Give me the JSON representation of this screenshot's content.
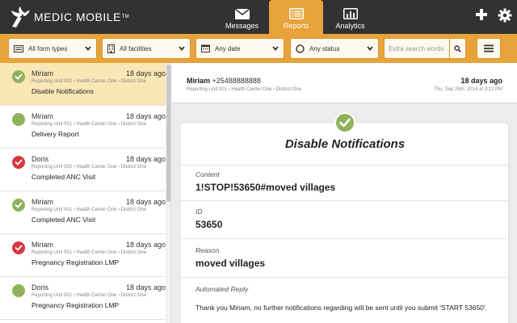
{
  "app": {
    "logo_text": "MEDIC MOBILE",
    "logo_tm": "TM"
  },
  "nav": {
    "tabs": [
      {
        "label": "Messages",
        "icon": "envelope-icon"
      },
      {
        "label": "Reports",
        "icon": "list-icon",
        "active": true
      },
      {
        "label": "Analytics",
        "icon": "bar-chart-icon"
      }
    ],
    "actions": [
      {
        "icon": "plus-icon"
      },
      {
        "icon": "gear-icon"
      }
    ]
  },
  "filters": {
    "form_types": "All form types",
    "facilities": "All facilities",
    "date": "Any date",
    "status": "Any status",
    "search_placeholder": "Extra search words",
    "search_icon": "search-icon",
    "menu_icon": "hamburger-icon"
  },
  "colors": {
    "accent": "#e8a33a",
    "topbar": "#323232",
    "selected": "#fbe6b6",
    "valid": "#8fb35a",
    "invalid": "#d9363e"
  },
  "reports": [
    {
      "name": "Miriam",
      "time": "18 days ago",
      "place": "Reporting Unit 001 › Health Center One › District One",
      "form": "Disable Notifications",
      "status": "valid",
      "verified": true,
      "selected": true
    },
    {
      "name": "Miriam",
      "time": "18 days ago",
      "place": "Reporting Unit 001 › Health Center One › District One",
      "form": "Delivery Report",
      "status": "valid",
      "verified": false,
      "selected": false
    },
    {
      "name": "Doris",
      "time": "18 days ago",
      "place": "Reporting Unit 002 › Health Center One › District One",
      "form": "Completed ANC Visit",
      "status": "invalid",
      "verified": true,
      "selected": false
    },
    {
      "name": "Miriam",
      "time": "18 days ago",
      "place": "Reporting Unit 001 › Health Center One › District One",
      "form": "Completed ANC Visit",
      "status": "valid",
      "verified": true,
      "selected": false
    },
    {
      "name": "Miriam",
      "time": "18 days ago",
      "place": "Reporting Unit 001 › Health Center One › District One",
      "form": "Pregnancy Registration LMP",
      "status": "invalid",
      "verified": true,
      "selected": false
    },
    {
      "name": "Doris",
      "time": "18 days ago",
      "place": "Reporting Unit 002 › Health Center One › District One",
      "form": "Pregnancy Registration LMP",
      "status": "valid",
      "verified": false,
      "selected": false
    }
  ],
  "detail": {
    "name": "Miriam",
    "phone": "+25488888888",
    "place": "Reporting Unit 001 › Health Center One › District One",
    "time": "18 days ago",
    "date": "Thu, Sep 25th, 2014 at 3:12 PM",
    "title": "Disable Notifications",
    "fields": [
      {
        "label": "Content",
        "value": "1!STOP!53650#moved villages"
      },
      {
        "label": "ID",
        "value": "53650"
      },
      {
        "label": "Reason",
        "value": "moved villages"
      }
    ],
    "reply_label": "Automated Reply",
    "reply_text": "Thank you Miriam, no further notifications regarding will be sent until you submit 'START 53650'."
  }
}
